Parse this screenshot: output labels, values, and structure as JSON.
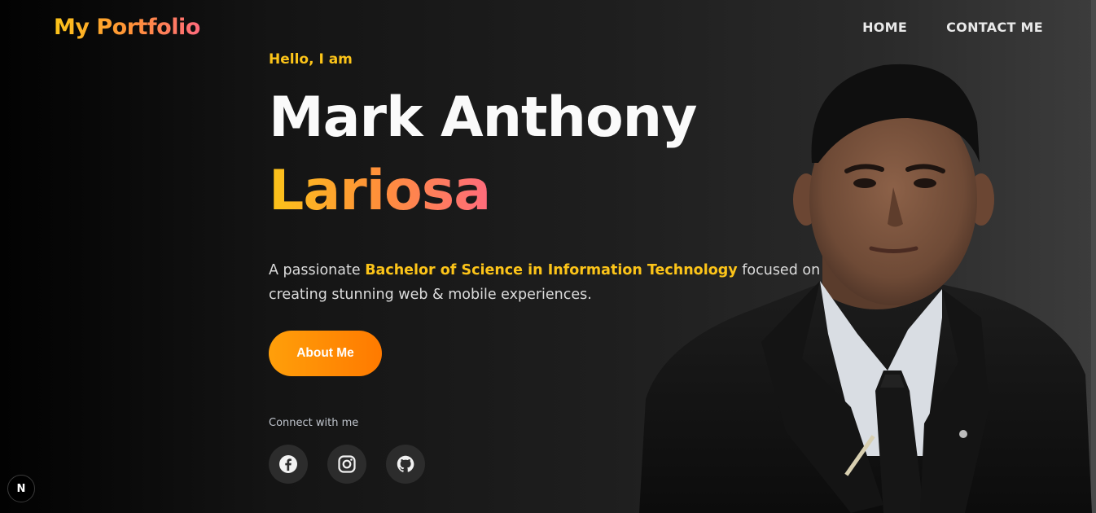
{
  "header": {
    "logo": "My Portfolio",
    "nav": [
      {
        "label": "HOME"
      },
      {
        "label": "CONTACT ME"
      }
    ]
  },
  "hero": {
    "greeting": "Hello, I am",
    "name_first": "Mark Anthony",
    "name_last": "Lariosa",
    "desc_prefix": "A passionate ",
    "desc_highlight": "Bachelor of Science in Information Technology",
    "desc_suffix": " focused on creating stunning web & mobile experiences.",
    "cta_label": "About Me",
    "connect_label": "Connect with me",
    "socials": [
      {
        "icon": "facebook-icon"
      },
      {
        "icon": "instagram-icon"
      },
      {
        "icon": "github-icon"
      }
    ]
  },
  "dev_badge": "N",
  "colors": {
    "accent_yellow": "#fcc419",
    "accent_orange": "#ff8f3a",
    "accent_pink": "#ff6b7d",
    "button": "#ff8c00"
  }
}
